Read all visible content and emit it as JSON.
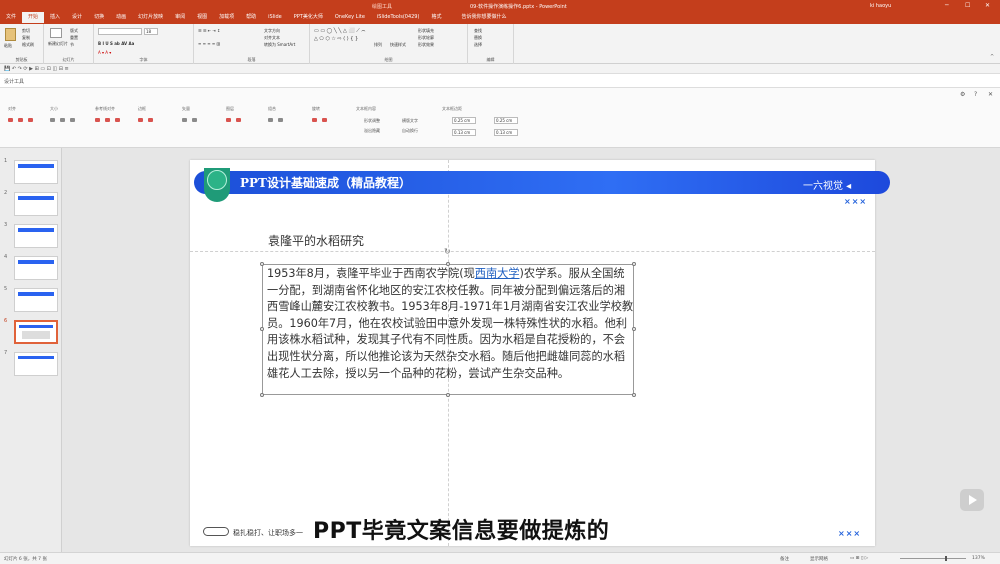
{
  "window": {
    "title": "09-软件操作演练操作6.pptx - PowerPoint",
    "context_tab_group": "绘图工具",
    "help_placeholder": "告诉我你想要做什么",
    "user": "ki haoyu"
  },
  "tabs": [
    "文件",
    "开始",
    "插入",
    "设计",
    "切换",
    "动画",
    "幻灯片放映",
    "审阅",
    "视图",
    "加载项",
    "帮助",
    "iSlide",
    "PPT美化大师",
    "OneKey Lite",
    "iSlideTools(0429)",
    "格式"
  ],
  "ribbon": {
    "groups": [
      "剪贴板",
      "幻灯片",
      "字体",
      "段落",
      "绘图",
      "编辑"
    ],
    "clipboard": {
      "paste": "粘贴",
      "cut": "剪切",
      "copy": "复制",
      "format_painter": "格式刷"
    },
    "slides": {
      "new_slide": "新建幻灯片",
      "layout": "版式",
      "reset": "重置",
      "section": "节"
    },
    "font": {
      "name": "",
      "size": "18"
    },
    "paragraph": {
      "text_direction": "文字方向",
      "align_text": "对齐文本",
      "smartart": "转换为 SmartArt"
    },
    "drawing": {
      "arrange": "排列",
      "quick_styles": "快速样式",
      "shape_fill": "形状填充",
      "shape_outline": "形状轮廓",
      "shape_effects": "形状效果"
    },
    "editing": {
      "find": "查找",
      "replace": "替换",
      "select": "选择"
    }
  },
  "toolstrip_label": "设计工具",
  "design_panel": {
    "groups": [
      "对齐",
      "大小",
      "参考线对齐",
      "边框",
      "矢量",
      "图层",
      "组合",
      "旋转",
      "文本框内容",
      "文本框边距"
    ],
    "options": {
      "opt1": "形状调整",
      "opt2": "横版文字",
      "opt3": "溢出隐藏",
      "opt4": "自动换行"
    },
    "margins": [
      "0.25 cm",
      "0.25 cm",
      "0.13 cm",
      "0.13 cm"
    ]
  },
  "thumbnails": [
    {
      "num": "1"
    },
    {
      "num": "2"
    },
    {
      "num": "3"
    },
    {
      "num": "4"
    },
    {
      "num": "5"
    },
    {
      "num": "6"
    },
    {
      "num": "7"
    }
  ],
  "slide": {
    "banner_title": "PPT设计基础速成（精品教程）",
    "banner_right": "一六视觉 ◂",
    "heading": "袁隆平的水稻研究",
    "body_pre": "1953年8月，袁隆平毕业于西南农学院(现",
    "body_link": "西南大学",
    "body_post": ")农学系。服从全国统一分配，到湖南省怀化地区的安江农校任教。同年被分配到偏远落后的湘西雪峰山麓安江农校教书。1953年8月-1971年1月湖南省安江农业学校教员。1960年7月，他在农校试验田中意外发现一株特殊性状的水稻。他利用该株水稻试种，发现其子代有不同性质。因为水稻是自花授粉的，不会出现性状分离，所以他推论该为天然杂交水稻。随后他把雌雄同蕊的水稻雄花人工去除，授以另一个品种的花粉，尝试产生杂交品种。",
    "crosses": "×××",
    "footer_left": "稳扎稳打、让职场多一",
    "video_subtitle": "PPT毕竟文案信息要做提炼的"
  },
  "status": {
    "slide_info": "幻灯片 6 张，共 7 张",
    "notes": "备注",
    "comments": "显示网格",
    "zoom": "137%"
  },
  "colors": {
    "accent": "#c43e1c",
    "banner": "#2a63f0",
    "logo": "#1f9b78"
  }
}
